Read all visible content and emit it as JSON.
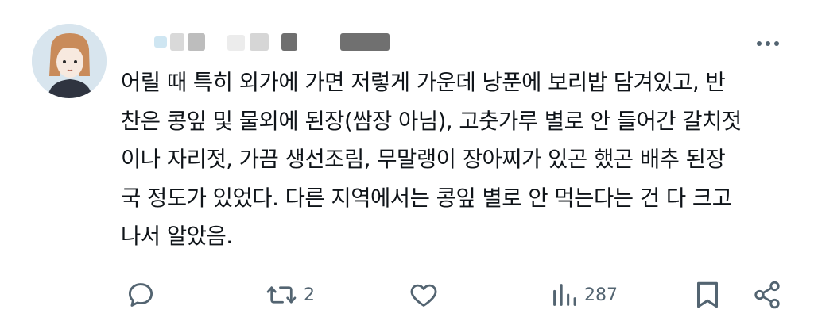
{
  "tweet": {
    "content_lines": [
      "어릴 때 특히 외가에 가면 저렇게 가운데 낭푼에 보리밥 담겨있고, 반",
      "찬은 콩잎 및 물외에 된장(쌈장 아님), 고춧가루 별로 안 들어간 갈치젓",
      "이나 자리젓, 가끔 생선조림, 무말랭이 장아찌가 있곤 했곤 배추 된장",
      "국 정도가 있었다. 다른 지역에서는 콩잎 별로 안 먹는다는 건 다 크고",
      "나서 알았음."
    ]
  },
  "actions": {
    "reply": {
      "icon": "reply-icon"
    },
    "retweet": {
      "icon": "retweet-icon",
      "count": "2"
    },
    "like": {
      "icon": "heart-icon"
    },
    "views": {
      "icon": "views-icon",
      "count": "287"
    },
    "bookmark": {
      "icon": "bookmark-icon"
    },
    "share": {
      "icon": "share-icon"
    }
  },
  "colors": {
    "text": "#0f1419",
    "icon": "#536471",
    "avatar_bg": "#d8e5ee"
  }
}
